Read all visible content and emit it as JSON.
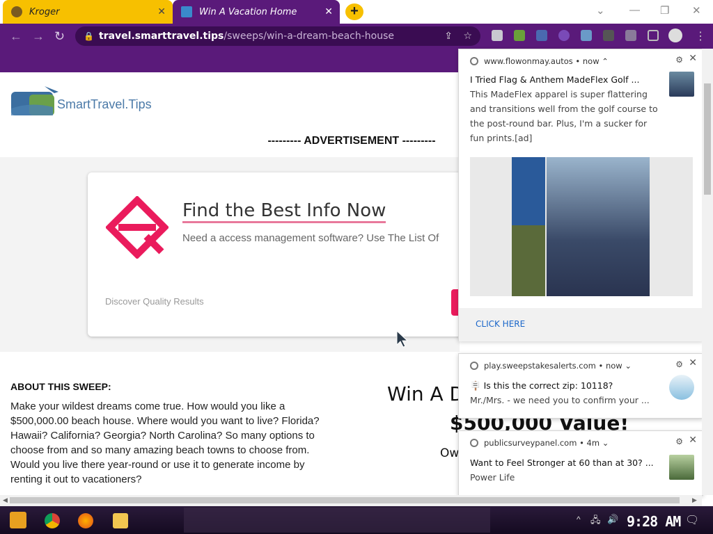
{
  "browser": {
    "tabs": [
      {
        "label": "Kroger",
        "active": false
      },
      {
        "label": "Win A Vacation Home",
        "active": true
      }
    ],
    "new_tab_label": "+",
    "url_host": "travel.smarttravel.tips",
    "url_path": "/sweeps/win-a-dream-beach-house"
  },
  "page": {
    "logo_brand": "SmartTravel.Tips",
    "advertisement_label": "--------- ADVERTISEMENT ---------",
    "ad": {
      "title": "Find the Best Info Now",
      "description": "Need a access management software? Use The List Of",
      "footer": "Discover Quality Results"
    },
    "about_heading": "ABOUT THIS SWEEP:",
    "about_text": "Make your wildest dreams come true. How would you like a $500,000.00 beach house. Where would you want to live? Florida? Hawaii? California? Georgia? North Carolina? So many options to choose from and so many amazing beach towns to choose from. Would you live there year-round or use it to generate income by renting it out to vacationers?",
    "win_title": "Win A  D",
    "win_value": "$500,000 Value!",
    "win_owner": "Ow"
  },
  "notifications": [
    {
      "source": "www.flowonmay.autos",
      "time": "now",
      "title": "I Tried Flag & Anthem MadeFlex Golf ...",
      "body": "This MadeFlex apparel is super flattering and transitions well from the golf course to the post-round bar. Plus, I'm a sucker for fun prints.[ad]",
      "action": "CLICK HERE"
    },
    {
      "source": "play.sweepstakesalerts.com",
      "time": "now",
      "title": "Is this the correct zip: 10118?",
      "body": "Mr./Mrs.  - we need you to confirm your ..."
    },
    {
      "source": "publicsurveypanel.com",
      "time": "4m",
      "title": "Want to Feel Stronger at 60 than at 30? ...",
      "body": "Power Life"
    }
  ],
  "taskbar": {
    "clock": "9:28 AM"
  },
  "colors": {
    "brand_purple": "#5a1a7a",
    "tab_yellow": "#f7c000",
    "ad_pink": "#ea1b5c"
  }
}
